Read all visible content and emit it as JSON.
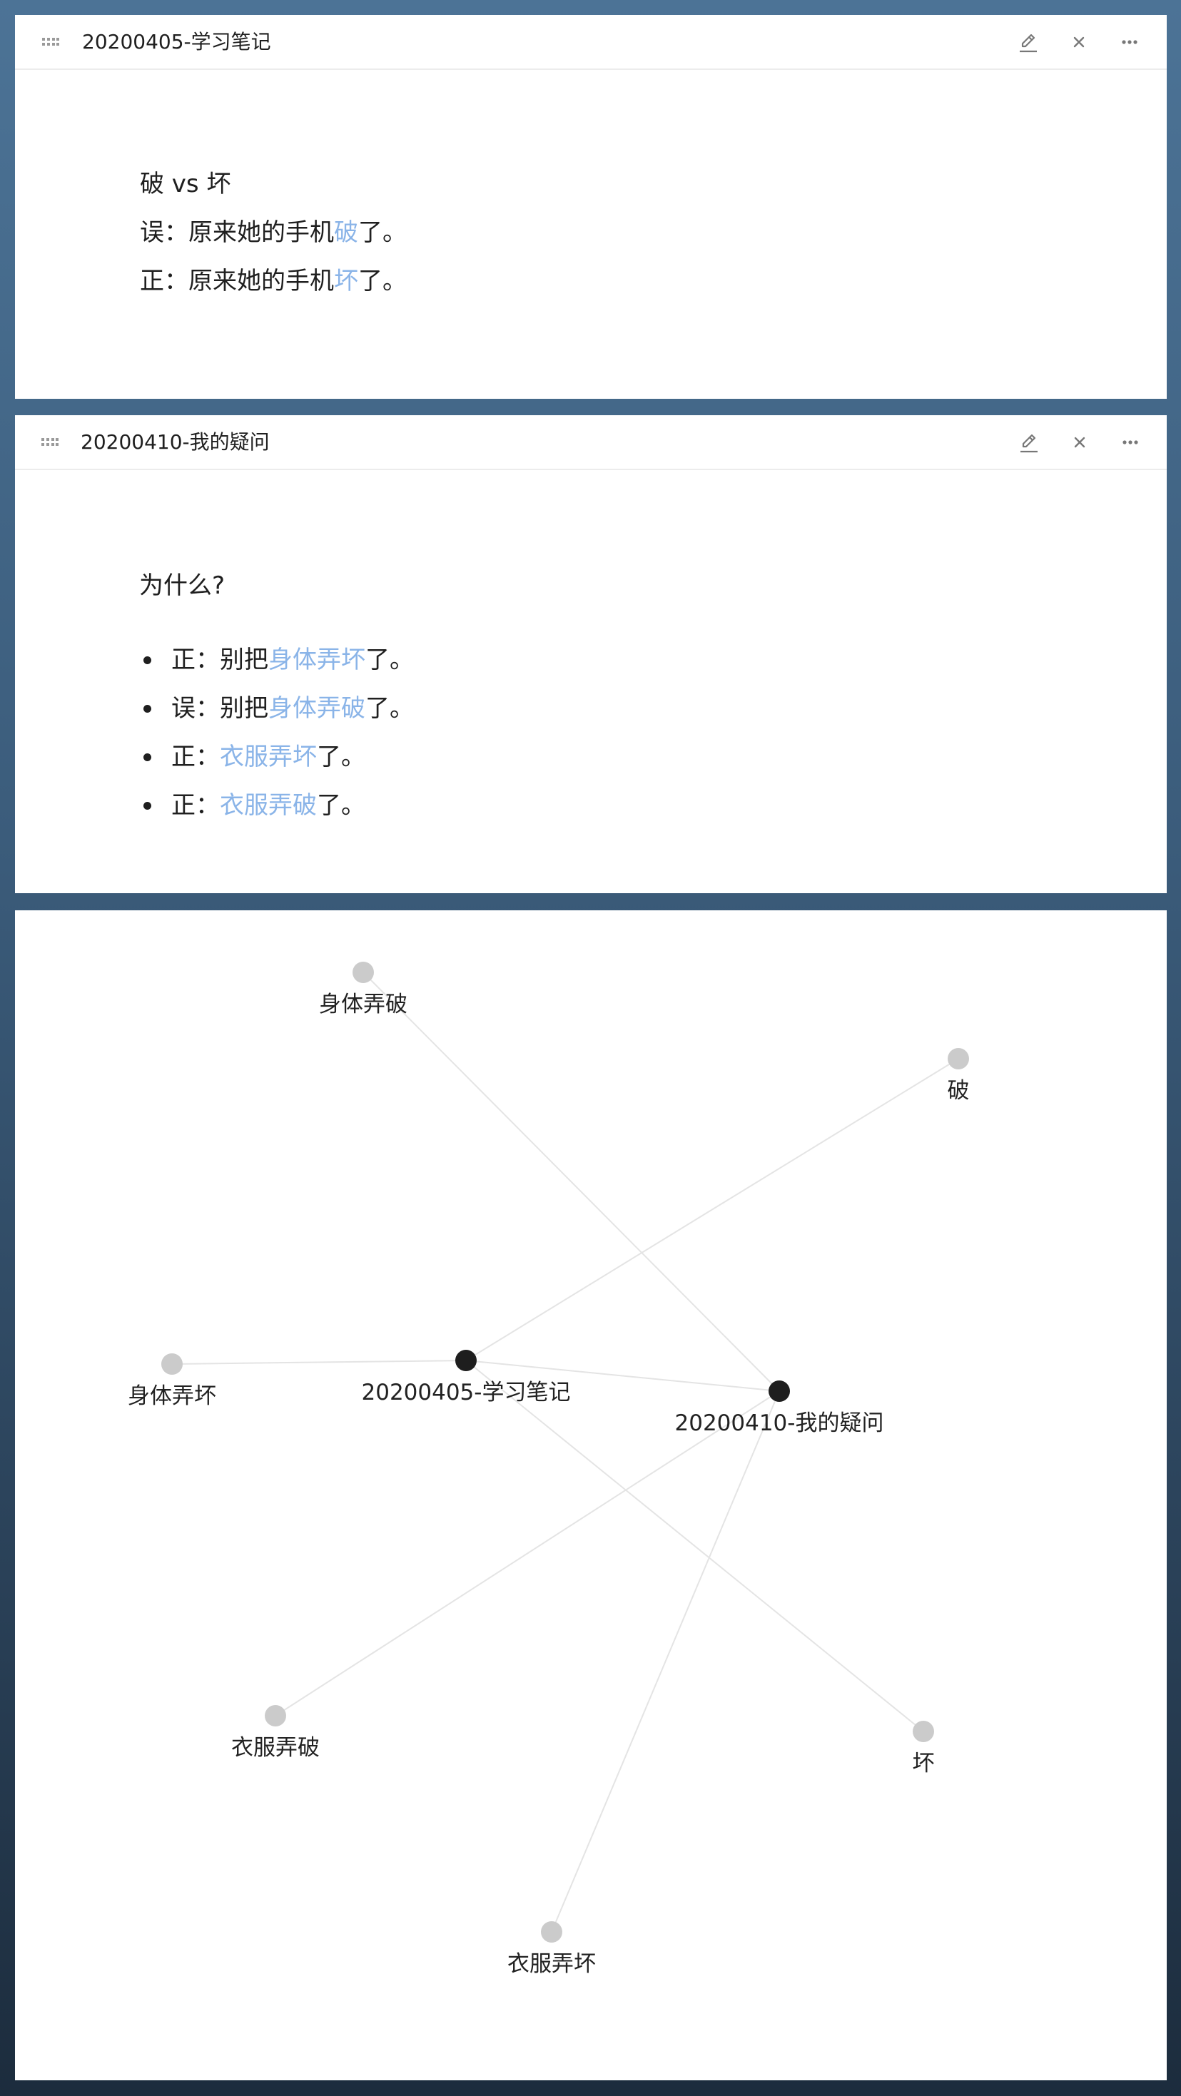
{
  "pane1": {
    "title": "20200405-学习笔记",
    "lines": [
      {
        "pre": "破 vs 坏",
        "link": "",
        "post": ""
      },
      {
        "pre": "误：原来她的手机",
        "link": "破",
        "post": "了。"
      },
      {
        "pre": "正：原来她的手机",
        "link": "坏",
        "post": "了。"
      }
    ]
  },
  "pane2": {
    "title": "20200410-我的疑问",
    "heading": "为什么?",
    "bullets": [
      {
        "pre": "正：别把",
        "link": "身体弄坏",
        "post": "了。"
      },
      {
        "pre": "误：别把",
        "link": "身体弄破",
        "post": "了。"
      },
      {
        "pre": "正：",
        "link": "衣服弄坏",
        "post": "了。"
      },
      {
        "pre": "正：",
        "link": "衣服弄破",
        "post": "了。"
      }
    ]
  },
  "toolbar": {
    "grip_icon": "drag-handle-icon",
    "edit_icon": "pencil-icon",
    "close_icon": "close-icon",
    "more_icon": "more-icon"
  },
  "graph": {
    "nodes": [
      {
        "id": "n1",
        "label": "20200405-学习笔记",
        "type": "note"
      },
      {
        "id": "n2",
        "label": "20200410-我的疑问",
        "type": "note"
      },
      {
        "id": "t1",
        "label": "身体弄破",
        "type": "term"
      },
      {
        "id": "t2",
        "label": "破",
        "type": "term"
      },
      {
        "id": "t3",
        "label": "身体弄坏",
        "type": "term"
      },
      {
        "id": "t4",
        "label": "衣服弄破",
        "type": "term"
      },
      {
        "id": "t5",
        "label": "坏",
        "type": "term"
      },
      {
        "id": "t6",
        "label": "衣服弄坏",
        "type": "term"
      }
    ],
    "edges": [
      [
        "n1",
        "t2"
      ],
      [
        "n1",
        "t3"
      ],
      [
        "n1",
        "n2"
      ],
      [
        "n1",
        "t5"
      ],
      [
        "n2",
        "t1"
      ],
      [
        "n2",
        "t4"
      ],
      [
        "n2",
        "t6"
      ]
    ],
    "colors": {
      "note": "#1e1e1e",
      "term": "#cbcbcb",
      "edge": "#e4e4e4",
      "link": "#8ab4e8"
    }
  }
}
